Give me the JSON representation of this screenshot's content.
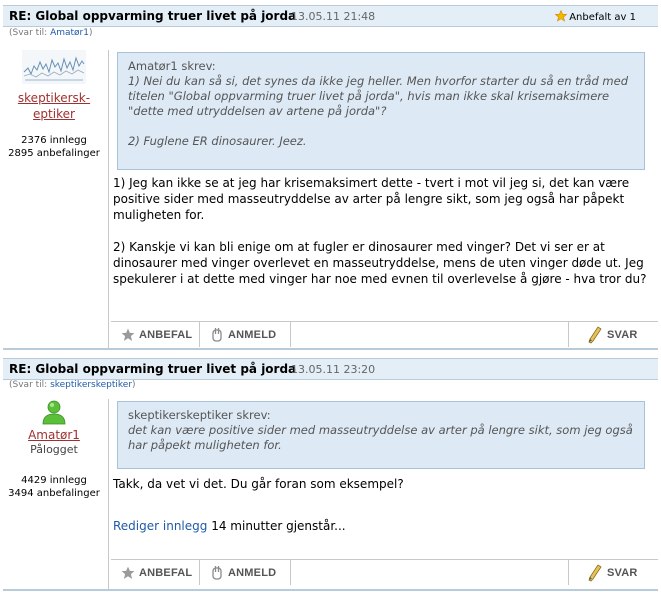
{
  "posts": [
    {
      "title": "RE: Global oppvarming truer livet på jorda",
      "date": "13.05.11 21:48",
      "recommended": "Anbefalt av 1",
      "reply_prefix": "(Svar til: ",
      "reply_to": "Amatør1",
      "reply_suffix": ")",
      "author": {
        "name_line1": "skeptikersk-",
        "name_line2": "eptiker",
        "posts": "2376 innlegg",
        "recs": "2895 anbefalinger"
      },
      "quote": {
        "header": "Amatør1 skrev:",
        "p1": "1) Nei du kan så si, det synes da ikke jeg heller. Men hvorfor starter du så en tråd med titelen \"Global oppvarming truer livet på jorda\", hvis man ikke skal krisemaksimere \"dette med utryddelsen av artene på jorda\"?",
        "p2": "2) Fuglene ER dinosaurer. Jeez."
      },
      "body": {
        "p1": "1) Jeg kan ikke se at jeg har krisemaksimert dette - tvert i mot vil jeg si, det kan være positive sider med masseutryddelse av arter på lengre sikt, som jeg også har påpekt muligheten for.",
        "p2": "2) Kanskje vi kan bli enige om at fugler er dinosaurer med vinger? Det vi ser er at dinosaurer med vinger overlevet en masseutryddelse, mens de uten vinger døde ut. Jeg spekulerer i at dette med vinger har noe med evnen til overlevelse å gjøre - hva tror du?"
      },
      "actions": {
        "recommend": "ANBEFAL",
        "report": "ANMELD",
        "reply": "SVAR"
      }
    },
    {
      "title": "RE: Global oppvarming truer livet på jorda",
      "date": "13.05.11 23:20",
      "reply_prefix": "(Svar til: ",
      "reply_to": "skeptikerskeptiker",
      "reply_suffix": ")",
      "author": {
        "name": "Amatør1",
        "status": "Pålogget",
        "posts": "4429 innlegg",
        "recs": "3494 anbefalinger"
      },
      "quote": {
        "header": "skeptikerskeptiker skrev:",
        "p1": "det kan være positive sider med masseutryddelse av arter på lengre sikt, som jeg også har påpekt muligheten for."
      },
      "body": {
        "p1": "Takk, da vet vi det. Du går foran som eksempel?",
        "edit_link": "Rediger innlegg",
        "edit_remaining": "14 minutter gjenstår..."
      },
      "actions": {
        "recommend": "ANBEFAL",
        "report": "ANMELD",
        "reply": "SVAR"
      }
    }
  ]
}
